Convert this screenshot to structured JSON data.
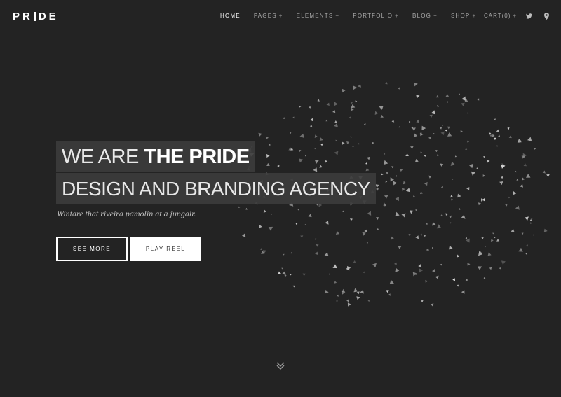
{
  "logo": {
    "text_part1": "PR",
    "text_part2": "DE"
  },
  "nav": {
    "items": [
      {
        "label": "HOME",
        "plus": ""
      },
      {
        "label": "PAGES",
        "plus": "+"
      },
      {
        "label": "ELEMENTS",
        "plus": "+"
      },
      {
        "label": "PORTFOLIO",
        "plus": "+"
      },
      {
        "label": "BLOG",
        "plus": "+"
      },
      {
        "label": "SHOP",
        "plus": "+"
      }
    ],
    "cart": {
      "label": "CART(0)",
      "plus": "+"
    },
    "icons": [
      "twitter-icon",
      "map-pin-icon"
    ]
  },
  "hero": {
    "line1_light": "WE ARE ",
    "line1_bold": "THE PRIDE",
    "line2": "DESIGN AND BRANDING AGENCY",
    "subtitle": "Wintare that riveira pamolin at a jungalr.",
    "btn_primary": "SEE MORE",
    "btn_secondary": "PLAY REEL"
  },
  "scroll_icon": "double-chevron-down-icon",
  "colors": {
    "background": "#232323",
    "text": "#ffffff",
    "nav_text": "#a9a9a9",
    "highlight_box": "#3c3c3c"
  }
}
